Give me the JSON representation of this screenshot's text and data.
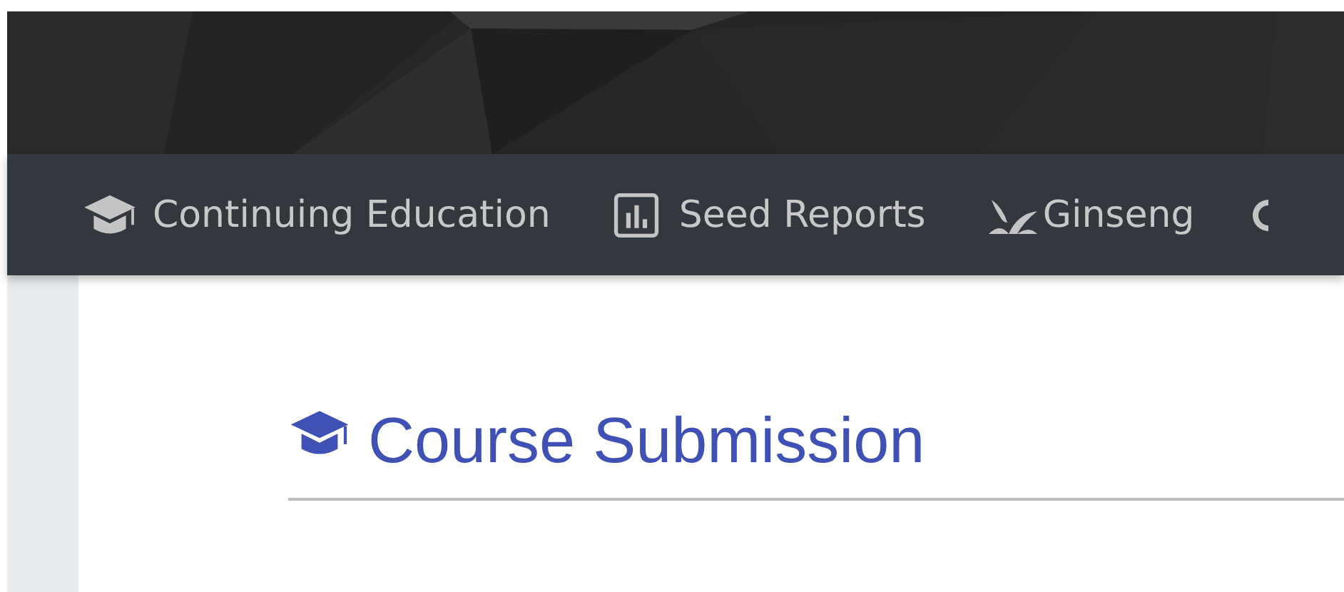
{
  "nav": {
    "items": [
      {
        "label": "Continuing Education"
      },
      {
        "label": "Seed Reports"
      },
      {
        "label": "Ginseng"
      }
    ]
  },
  "heading": {
    "title": "Course Submission"
  }
}
